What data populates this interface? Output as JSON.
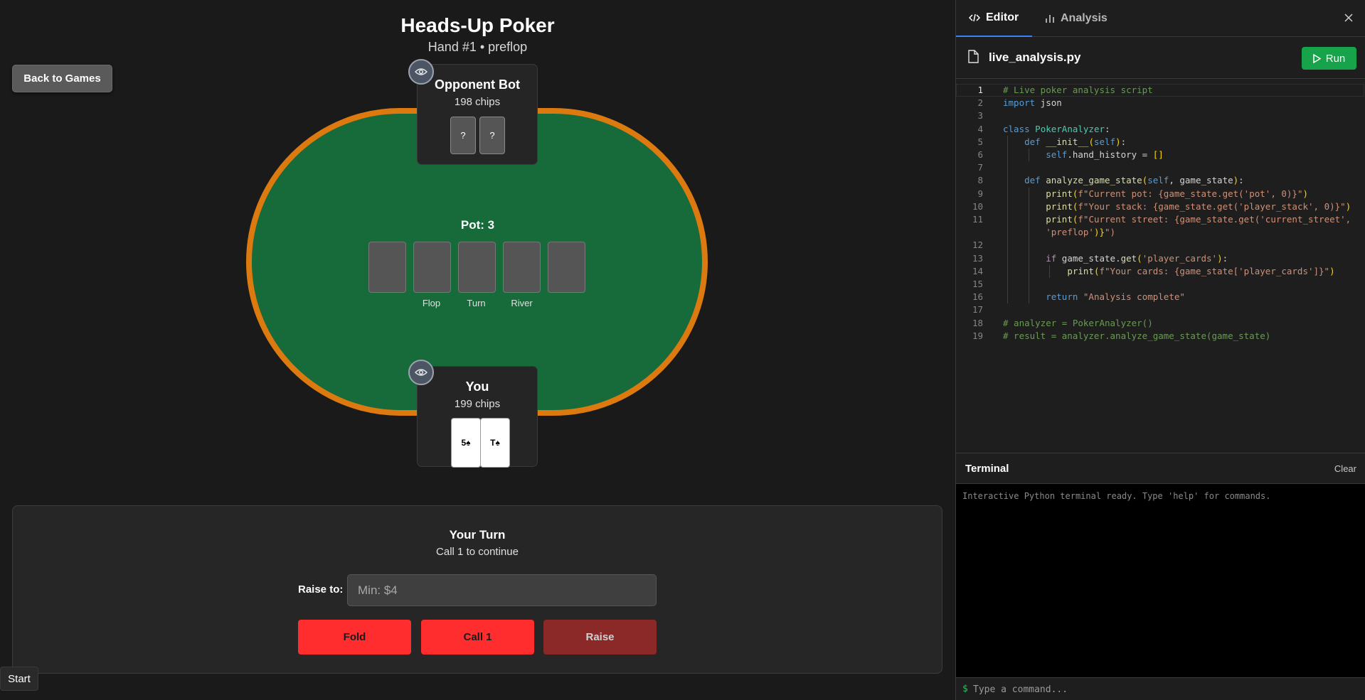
{
  "game": {
    "title": "Heads-Up Poker",
    "subtitle": "Hand #1 • preflop",
    "back_label": "Back to Games",
    "opponent": {
      "name": "Opponent Bot",
      "chips": "198 chips",
      "cards": [
        "?",
        "?"
      ]
    },
    "player": {
      "name": "You",
      "chips": "199 chips",
      "cards": [
        "5♠",
        "T♠"
      ]
    },
    "pot": "Pot: 3",
    "board_labels": [
      "Flop",
      "Turn",
      "River"
    ],
    "action": {
      "title": "Your Turn",
      "subtitle": "Call 1 to continue",
      "raise_label": "Raise to:",
      "raise_placeholder": "Min: $4",
      "fold_label": "Fold",
      "call_label": "Call 1",
      "raise_button_label": "Raise"
    },
    "start_label": "Start",
    "colors": {
      "felt": "#176a3a",
      "rail": "#dc7a10",
      "action_red": "#ff2d2d",
      "raise_disabled": "#8b2828"
    }
  },
  "side": {
    "tabs": [
      {
        "label": "Editor",
        "icon": "code-icon"
      },
      {
        "label": "Analysis",
        "icon": "bar-chart-icon"
      }
    ],
    "file": {
      "name": "live_analysis.py",
      "icon": "file-icon"
    },
    "run_label": "Run",
    "code_lines": [
      "# Live poker analysis script",
      "import json",
      "",
      "class PokerAnalyzer:",
      "    def __init__(self):",
      "        self.hand_history = []",
      "",
      "    def analyze_game_state(self, game_state):",
      "        print(f\"Current pot: {game_state.get('pot', 0)}\")",
      "        print(f\"Your stack: {game_state.get('player_stack', 0)}\")",
      "        print(f\"Current street: {game_state.get('current_street',",
      "        'preflop')}\")",
      "",
      "        if game_state.get('player_cards'):",
      "            print(f\"Your cards: {game_state['player_cards']}\")",
      "",
      "        return \"Analysis complete\"",
      "",
      "# analyzer = PokerAnalyzer()",
      "# result = analyzer.analyze_game_state(game_state)"
    ],
    "line_numbers": [
      "1",
      "2",
      "3",
      "4",
      "5",
      "6",
      "7",
      "8",
      "9",
      "10",
      "11",
      "",
      "12",
      "13",
      "14",
      "15",
      "16",
      "17",
      "18",
      "19"
    ],
    "terminal": {
      "title": "Terminal",
      "clear_label": "Clear",
      "message": "Interactive Python terminal ready. Type 'help' for commands.",
      "prompt": "$",
      "input_placeholder": "Type a command..."
    }
  }
}
